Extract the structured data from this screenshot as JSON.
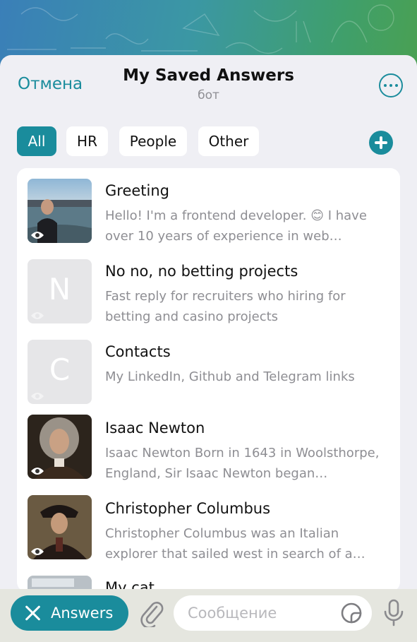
{
  "header": {
    "cancel_label": "Отмена",
    "title": "My Saved Answers",
    "subtitle": "бот",
    "more_icon": "more-horizontal-circle-icon"
  },
  "tabs": [
    {
      "label": "All",
      "active": true
    },
    {
      "label": "HR",
      "active": false
    },
    {
      "label": "People",
      "active": false
    },
    {
      "label": "Other",
      "active": false
    }
  ],
  "add_icon": "plus-circle-icon",
  "answers": [
    {
      "title": "Greeting",
      "description": "Hello! I'm a frontend developer. 😊 I have\nover 10 years of experience in web…",
      "thumbnail": "photo",
      "letter": ""
    },
    {
      "title": "No no, no betting projects",
      "description": "Fast reply for recruiters who hiring for\nbetting and casino projects",
      "thumbnail": "letter",
      "letter": "N"
    },
    {
      "title": "Contacts",
      "description": "My LinkedIn, Github and Telegram links",
      "thumbnail": "letter",
      "letter": "C"
    },
    {
      "title": "Isaac Newton",
      "description": "Isaac Newton Born in 1643 in Woolsthorpe,\nEngland, Sir Isaac Newton began…",
      "thumbnail": "photo",
      "letter": ""
    },
    {
      "title": "Christopher Columbus",
      "description": "Christopher Columbus was an Italian\nexplorer that sailed west in search of a…",
      "thumbnail": "photo",
      "letter": ""
    },
    {
      "title": "My cat",
      "description": "",
      "thumbnail": "photo",
      "letter": ""
    }
  ],
  "bottombar": {
    "answers_label": "Answers",
    "message_placeholder": "Сообщение",
    "icons": [
      "close-icon",
      "paperclip-icon",
      "sticker-icon",
      "microphone-icon"
    ]
  },
  "colors": {
    "accent": "#1a8c9c",
    "background": "#efeff4",
    "secondary_text": "#8e8e93"
  }
}
